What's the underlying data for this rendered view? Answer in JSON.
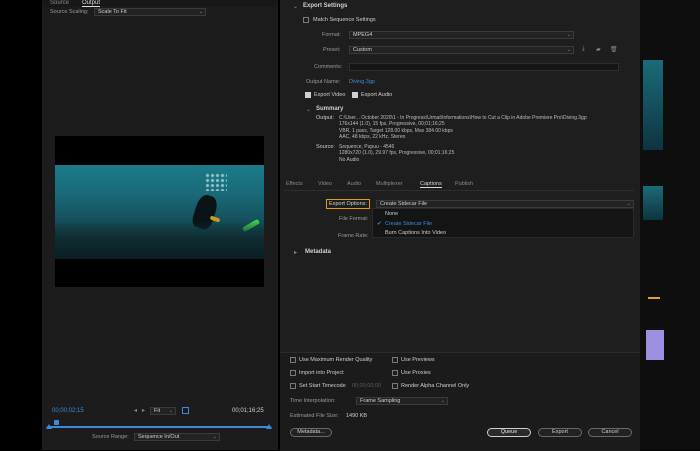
{
  "left": {
    "tabs": [
      "Source",
      "Output"
    ],
    "source_scaling_label": "Source Scaling:",
    "source_scaling_value": "Scale To Fit",
    "timecode_current": "00;00;02;15",
    "timecode_end": "00;01;16;25",
    "zoom_value": "Fit",
    "source_range_label": "Source Range:",
    "source_range_value": "Sequence In/Out"
  },
  "export_settings": {
    "title": "Export Settings",
    "match_sequence_label": "Match Sequence Settings",
    "format_label": "Format:",
    "format_value": "MPEG4",
    "preset_label": "Preset:",
    "preset_value": "Custom",
    "comments_label": "Comments:",
    "output_name_label": "Output Name:",
    "output_name_value": "Diving.3gp",
    "export_video_label": "Export Video",
    "export_audio_label": "Export Audio"
  },
  "summary": {
    "title": "Summary",
    "output_label": "Output:",
    "output_lines": [
      "C:\\User... October 2020\\1 - In Progress\\Urmat\\Informations\\How to Cut a Clip in Adobe Premiere Pro\\Diving.3gp",
      "176x144 (1.0), 15 fps, Progressive, 00;01;16;25",
      "VBR, 1 pass, Target 128.00 kbps, Max 384.00 kbps",
      "AAC, 48 kbps, 22 kHz, Stereo"
    ],
    "source_label": "Source:",
    "source_lines": [
      "Sequence, Pupuu - 4546",
      "1280x720 (1.0), 29.97 fps, Progressive, 00;01;16;25",
      "No Audio"
    ]
  },
  "tabs2": [
    "Effects",
    "Video",
    "Audio",
    "Multiplexer",
    "Captions",
    "Publish"
  ],
  "captions": {
    "export_options_label": "Export Options:",
    "export_options_value": "Create Sidecar File",
    "file_format_label": "File Format:",
    "frame_rate_label": "Frame Rate:",
    "dropdown_items": [
      "None",
      "Create Sidecar File",
      "Burn Captions Into Video"
    ]
  },
  "metadata_section": "Metadata",
  "bottom": {
    "use_max_quality": "Use Maximum Render Quality",
    "use_previews": "Use Previews",
    "import_into_project": "Import into Project",
    "use_proxies": "Use Proxies",
    "set_start_timecode": "Set Start Timecode",
    "start_timecode_value": "00;00;00;00",
    "render_alpha": "Render Alpha Channel Only",
    "time_interp_label": "Time Interpolation:",
    "time_interp_value": "Frame Sampling",
    "est_size_label": "Estimated File Size:",
    "est_size_value": "1490 KB",
    "metadata_btn": "Metadata...",
    "queue_btn": "Queue",
    "export_btn": "Export",
    "cancel_btn": "Cancel"
  },
  "colors": {
    "accent_blue": "#3a8bd8",
    "highlight_orange": "#e09a14"
  }
}
